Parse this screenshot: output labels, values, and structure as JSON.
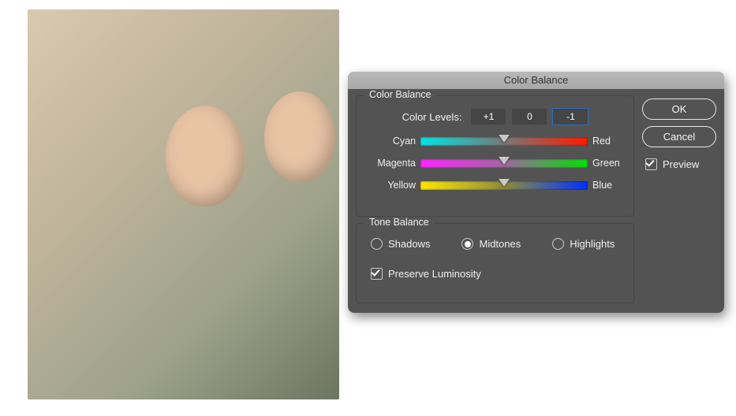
{
  "dialog": {
    "title": "Color Balance",
    "group_color": "Color Balance",
    "group_tone": "Tone Balance",
    "levels_label": "Color Levels:",
    "levels": {
      "cyan_red": "+1",
      "magenta_green": "0",
      "yellow_blue": "-1"
    },
    "sliders": [
      {
        "left": "Cyan",
        "right": "Red"
      },
      {
        "left": "Magenta",
        "right": "Green"
      },
      {
        "left": "Yellow",
        "right": "Blue"
      }
    ],
    "tone": {
      "shadows": "Shadows",
      "midtones": "Midtones",
      "highlights": "Highlights",
      "selected": "midtones"
    },
    "preserve_label": "Preserve Luminosity",
    "preserve_checked": true,
    "ok": "OK",
    "cancel": "Cancel",
    "preview_label": "Preview",
    "preview_checked": true
  }
}
